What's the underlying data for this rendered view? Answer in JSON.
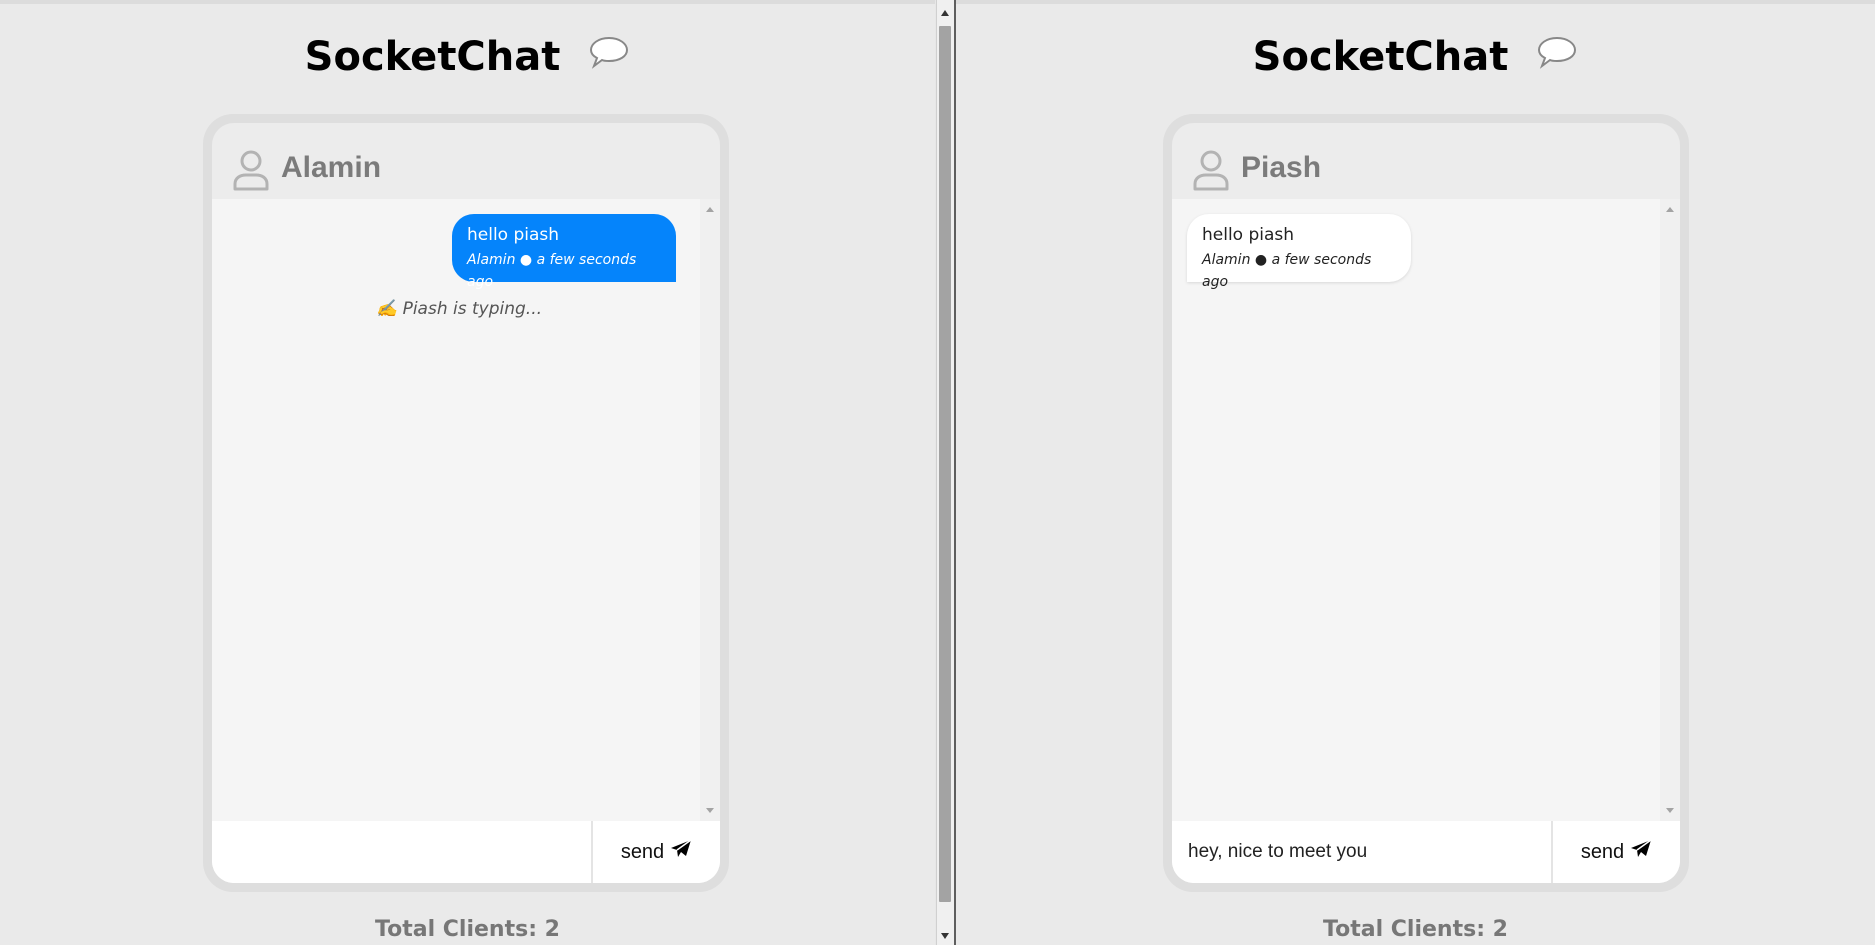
{
  "app_title": "SocketChat",
  "windows": [
    {
      "user": "Alamin",
      "messages": [
        {
          "text": "hello piash",
          "sender": "Alamin",
          "time": "a few seconds ago",
          "meta": "Alamin ● a few seconds ago",
          "direction": "outgoing"
        }
      ],
      "typing_text": "✍️ Piash is typing...",
      "input_value": "",
      "send_label": "send",
      "total_clients": "Total Clients: 2"
    },
    {
      "user": "Piash",
      "messages": [
        {
          "text": "hello piash",
          "sender": "Alamin",
          "time": "a few seconds ago",
          "meta": "Alamin ● a few seconds ago",
          "direction": "incoming"
        }
      ],
      "typing_text": "",
      "input_value": "hey, nice to meet you",
      "send_label": "send",
      "total_clients": "Total Clients: 2"
    }
  ],
  "icons": {
    "brand": "speech-bubble-icon",
    "user": "user-icon",
    "send": "paper-plane-icon"
  },
  "colors": {
    "outgoing_bubble": "#0584fb",
    "incoming_bubble": "#ffffff",
    "page_background": "#eaeaea",
    "username": "#7b7b7b"
  }
}
